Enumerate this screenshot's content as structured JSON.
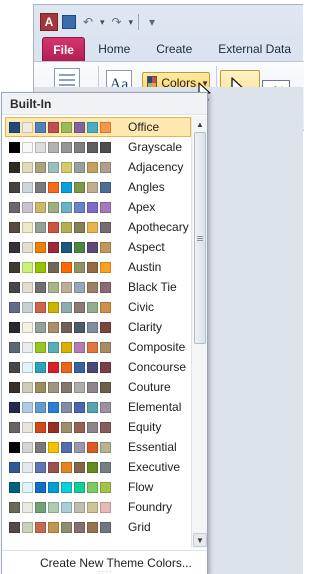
{
  "app": {
    "icon_letter": "A"
  },
  "tabs": [
    {
      "label": "File"
    },
    {
      "label": "Home"
    },
    {
      "label": "Create"
    },
    {
      "label": "External Data"
    }
  ],
  "ribbon": {
    "colors_label": "Colors",
    "textbox_label": "ab|"
  },
  "dropdown": {
    "header": "Built-In",
    "footer_action": "Create New Theme Colors...",
    "selected": "Office",
    "themes": [
      {
        "name": "Office",
        "colors": [
          "#1f497d",
          "#eeece1",
          "#4f81bd",
          "#c0504d",
          "#9bbb59",
          "#8064a2",
          "#4bacc6",
          "#f79646"
        ]
      },
      {
        "name": "Grayscale",
        "colors": [
          "#000000",
          "#f8f8f8",
          "#dddddd",
          "#b2b2b2",
          "#969696",
          "#808080",
          "#5f5f5f",
          "#4d4d4d"
        ]
      },
      {
        "name": "Adjacency",
        "colors": [
          "#2f2b20",
          "#dfdcb7",
          "#a9a57c",
          "#9cbebd",
          "#d2cb6c",
          "#95a39d",
          "#c89f5d",
          "#b1a089"
        ]
      },
      {
        "name": "Angles",
        "colors": [
          "#434342",
          "#cdd7d9",
          "#797b7e",
          "#f96a1b",
          "#08a1d9",
          "#7c984a",
          "#c2ad8d",
          "#506e94"
        ]
      },
      {
        "name": "Apex",
        "colors": [
          "#69676d",
          "#c9c2d1",
          "#ceb966",
          "#9cb084",
          "#6bb1c9",
          "#6585cf",
          "#7e6bc9",
          "#a379bb"
        ]
      },
      {
        "name": "Apothecary",
        "colors": [
          "#564b3c",
          "#ece9c6",
          "#93a299",
          "#cf543f",
          "#b5ae53",
          "#848058",
          "#e8b54d",
          "#786c71"
        ]
      },
      {
        "name": "Aspect",
        "colors": [
          "#323232",
          "#e3ded1",
          "#f07f09",
          "#9f2936",
          "#1b587c",
          "#4e8542",
          "#604878",
          "#c19859"
        ]
      },
      {
        "name": "Austin",
        "colors": [
          "#3e3d2d",
          "#caf278",
          "#94c600",
          "#71685a",
          "#ff6700",
          "#909465",
          "#956b43",
          "#fea022"
        ]
      },
      {
        "name": "Black Tie",
        "colors": [
          "#46464a",
          "#e3dcd1",
          "#6f6f74",
          "#a7b789",
          "#beae98",
          "#92a9b9",
          "#9c8265",
          "#8d6974"
        ]
      },
      {
        "name": "Civic",
        "colors": [
          "#646b86",
          "#c5d1d7",
          "#d16349",
          "#ccb400",
          "#8cadae",
          "#8c7b70",
          "#8fb08c",
          "#d19049"
        ]
      },
      {
        "name": "Clarity",
        "colors": [
          "#292934",
          "#f3f2dc",
          "#93a299",
          "#ad8f67",
          "#726056",
          "#4c5a6a",
          "#808da0",
          "#79463d"
        ]
      },
      {
        "name": "Composite",
        "colors": [
          "#5b6973",
          "#e7ecee",
          "#98c723",
          "#59b0b9",
          "#deae00",
          "#b77bb4",
          "#e0773c",
          "#a98d63"
        ]
      },
      {
        "name": "Concourse",
        "colors": [
          "#464646",
          "#def5fa",
          "#2da2bf",
          "#da1f28",
          "#eb641b",
          "#39639d",
          "#474b78",
          "#7d3c4a"
        ]
      },
      {
        "name": "Couture",
        "colors": [
          "#37302a",
          "#d0ccb9",
          "#9e8e5c",
          "#a09781",
          "#85776d",
          "#aeafa9",
          "#8d878b",
          "#6b6149"
        ]
      },
      {
        "name": "Elemental",
        "colors": [
          "#242852",
          "#acccea",
          "#629dd1",
          "#297fd5",
          "#7f8fa9",
          "#4a66ac",
          "#5aa2ae",
          "#9d90a0"
        ]
      },
      {
        "name": "Equity",
        "colors": [
          "#696464",
          "#e9e5dc",
          "#d34817",
          "#9b2d1f",
          "#a28e6a",
          "#956251",
          "#918485",
          "#855d5d"
        ]
      },
      {
        "name": "Essential",
        "colors": [
          "#000000",
          "#d5d5d5",
          "#7a7a7a",
          "#f5c201",
          "#526db0",
          "#989aac",
          "#dc5924",
          "#b4b392"
        ]
      },
      {
        "name": "Executive",
        "colors": [
          "#2f5897",
          "#e4e9ef",
          "#6076b4",
          "#9c5252",
          "#e68422",
          "#846648",
          "#63891f",
          "#758085"
        ]
      },
      {
        "name": "Flow",
        "colors": [
          "#04617b",
          "#dbf5f9",
          "#0f6fc6",
          "#009dd9",
          "#0bd0d9",
          "#10cf9b",
          "#7cca62",
          "#a5c249"
        ]
      },
      {
        "name": "Foundry",
        "colors": [
          "#676a55",
          "#eaebde",
          "#72a376",
          "#b0ccb0",
          "#a8cdd7",
          "#c0beaf",
          "#cec597",
          "#e8b7b7"
        ]
      },
      {
        "name": "Grid",
        "colors": [
          "#534949",
          "#ccd1b9",
          "#c66951",
          "#bf974d",
          "#928b70",
          "#87706b",
          "#94734e",
          "#6f777d"
        ]
      }
    ]
  }
}
